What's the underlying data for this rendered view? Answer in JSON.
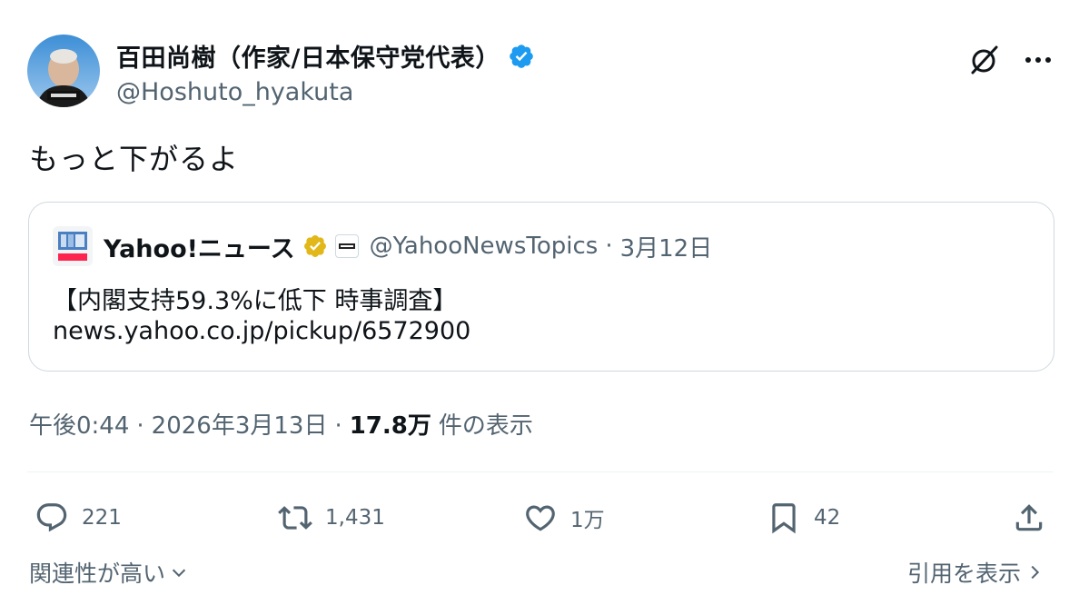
{
  "author": {
    "display_name": "百田尚樹（作家/日本保守党代表）",
    "handle": "@Hoshuto_hyakuta",
    "avatar_icon": "profile-photo",
    "verified_icon": "blue-verified-badge"
  },
  "header_icons": {
    "grok": "grok-icon",
    "more": "more-icon"
  },
  "tweet": {
    "text": "もっと下がるよ"
  },
  "quoted": {
    "name": "Yahoo!ニュース",
    "handle": "@YahooNewsTopics",
    "separator": "·",
    "date": "3月12日",
    "title": "【内閣支持59.3%に低下 時事調査】",
    "link": "news.yahoo.co.jp/pickup/6572900",
    "verified_icon": "gold-verified-badge",
    "affiliate_icon": "line-yahoo-badge"
  },
  "meta": {
    "time": "午後0:44",
    "separator": "·",
    "date": "2026年3月13日",
    "views_count": "17.8万",
    "views_label": "件の表示"
  },
  "actions": {
    "replies": "221",
    "retweets": "1,431",
    "likes": "1万",
    "bookmarks": "42"
  },
  "footer": {
    "sort_label": "関連性が高い",
    "quotes_label": "引用を表示"
  },
  "colors": {
    "text": "#0f1419",
    "secondary": "#536471",
    "border": "#cfd9de",
    "verified_blue": "#1d9bf0",
    "verified_gold": "#e2b719"
  }
}
